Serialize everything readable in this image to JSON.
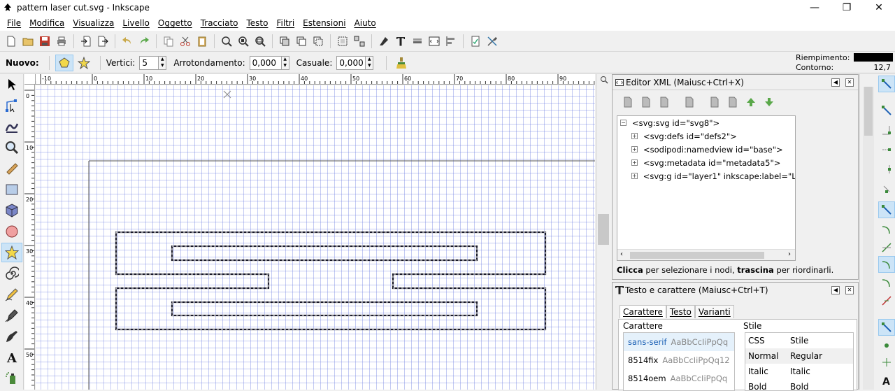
{
  "window": {
    "title": "pattern laser cut.svg - Inkscape"
  },
  "menu": {
    "items": [
      "File",
      "Modifica",
      "Visualizza",
      "Livello",
      "Oggetto",
      "Tracciato",
      "Testo",
      "Filtri",
      "Estensioni",
      "Aiuto"
    ]
  },
  "tool_controls": {
    "new_label": "Nuovo:",
    "vertices_label": "Vertici:",
    "vertices_value": "5",
    "rounding_label": "Arrotondamento:",
    "rounding_value": "0,000",
    "random_label": "Casuale:",
    "random_value": "0,000"
  },
  "fill_stroke": {
    "fill_label": "Riempimento:",
    "stroke_label": "Contorno:",
    "stroke_width": "12,7",
    "fill_color": "#000000"
  },
  "rulers": {
    "h_ticks": [
      "-10",
      "0",
      "10",
      "20",
      "30",
      "40",
      "50",
      "60",
      "70",
      "80",
      "90",
      "100"
    ],
    "v_ticks": [
      "0",
      "10",
      "20",
      "30",
      "40",
      "50",
      "60",
      "70",
      "80",
      "90"
    ]
  },
  "xml_editor": {
    "title": "Editor XML (Maiusc+Ctrl+X)",
    "nodes": [
      "<svg:svg id=\"svg8\">",
      "<svg:defs id=\"defs2\">",
      "<sodipodi:namedview id=\"base\">",
      "<svg:metadata id=\"metadata5\">",
      "<svg:g id=\"layer1\" inkscape:label=\"Livell"
    ],
    "hint_bold1": "Clicca",
    "hint_text1": " per selezionare i nodi, ",
    "hint_bold2": "trascina",
    "hint_text2": " per riordinarli."
  },
  "text_panel": {
    "title": "Testo e carattere (Maiusc+Ctrl+T)",
    "tabs": [
      "Carattere",
      "Testo",
      "Varianti"
    ],
    "font_group": "Carattere",
    "style_group": "Stile",
    "fonts": [
      {
        "name": "sans-serif",
        "sample": "AaBbCcIiPpQq"
      },
      {
        "name": "8514fix",
        "sample": "AaBbCcIiPpQq12"
      },
      {
        "name": "8514oem",
        "sample": "AaBbCcIiPpQq"
      }
    ],
    "style_headers": [
      "CSS",
      "Stile"
    ],
    "styles": [
      [
        "Normal",
        "Regular"
      ],
      [
        "Italic",
        "Italic"
      ],
      [
        "Bold",
        "Bold"
      ]
    ]
  },
  "colors": {
    "accent": "#cce4f7",
    "grid": "#5a6edc",
    "selection": "#000000"
  }
}
